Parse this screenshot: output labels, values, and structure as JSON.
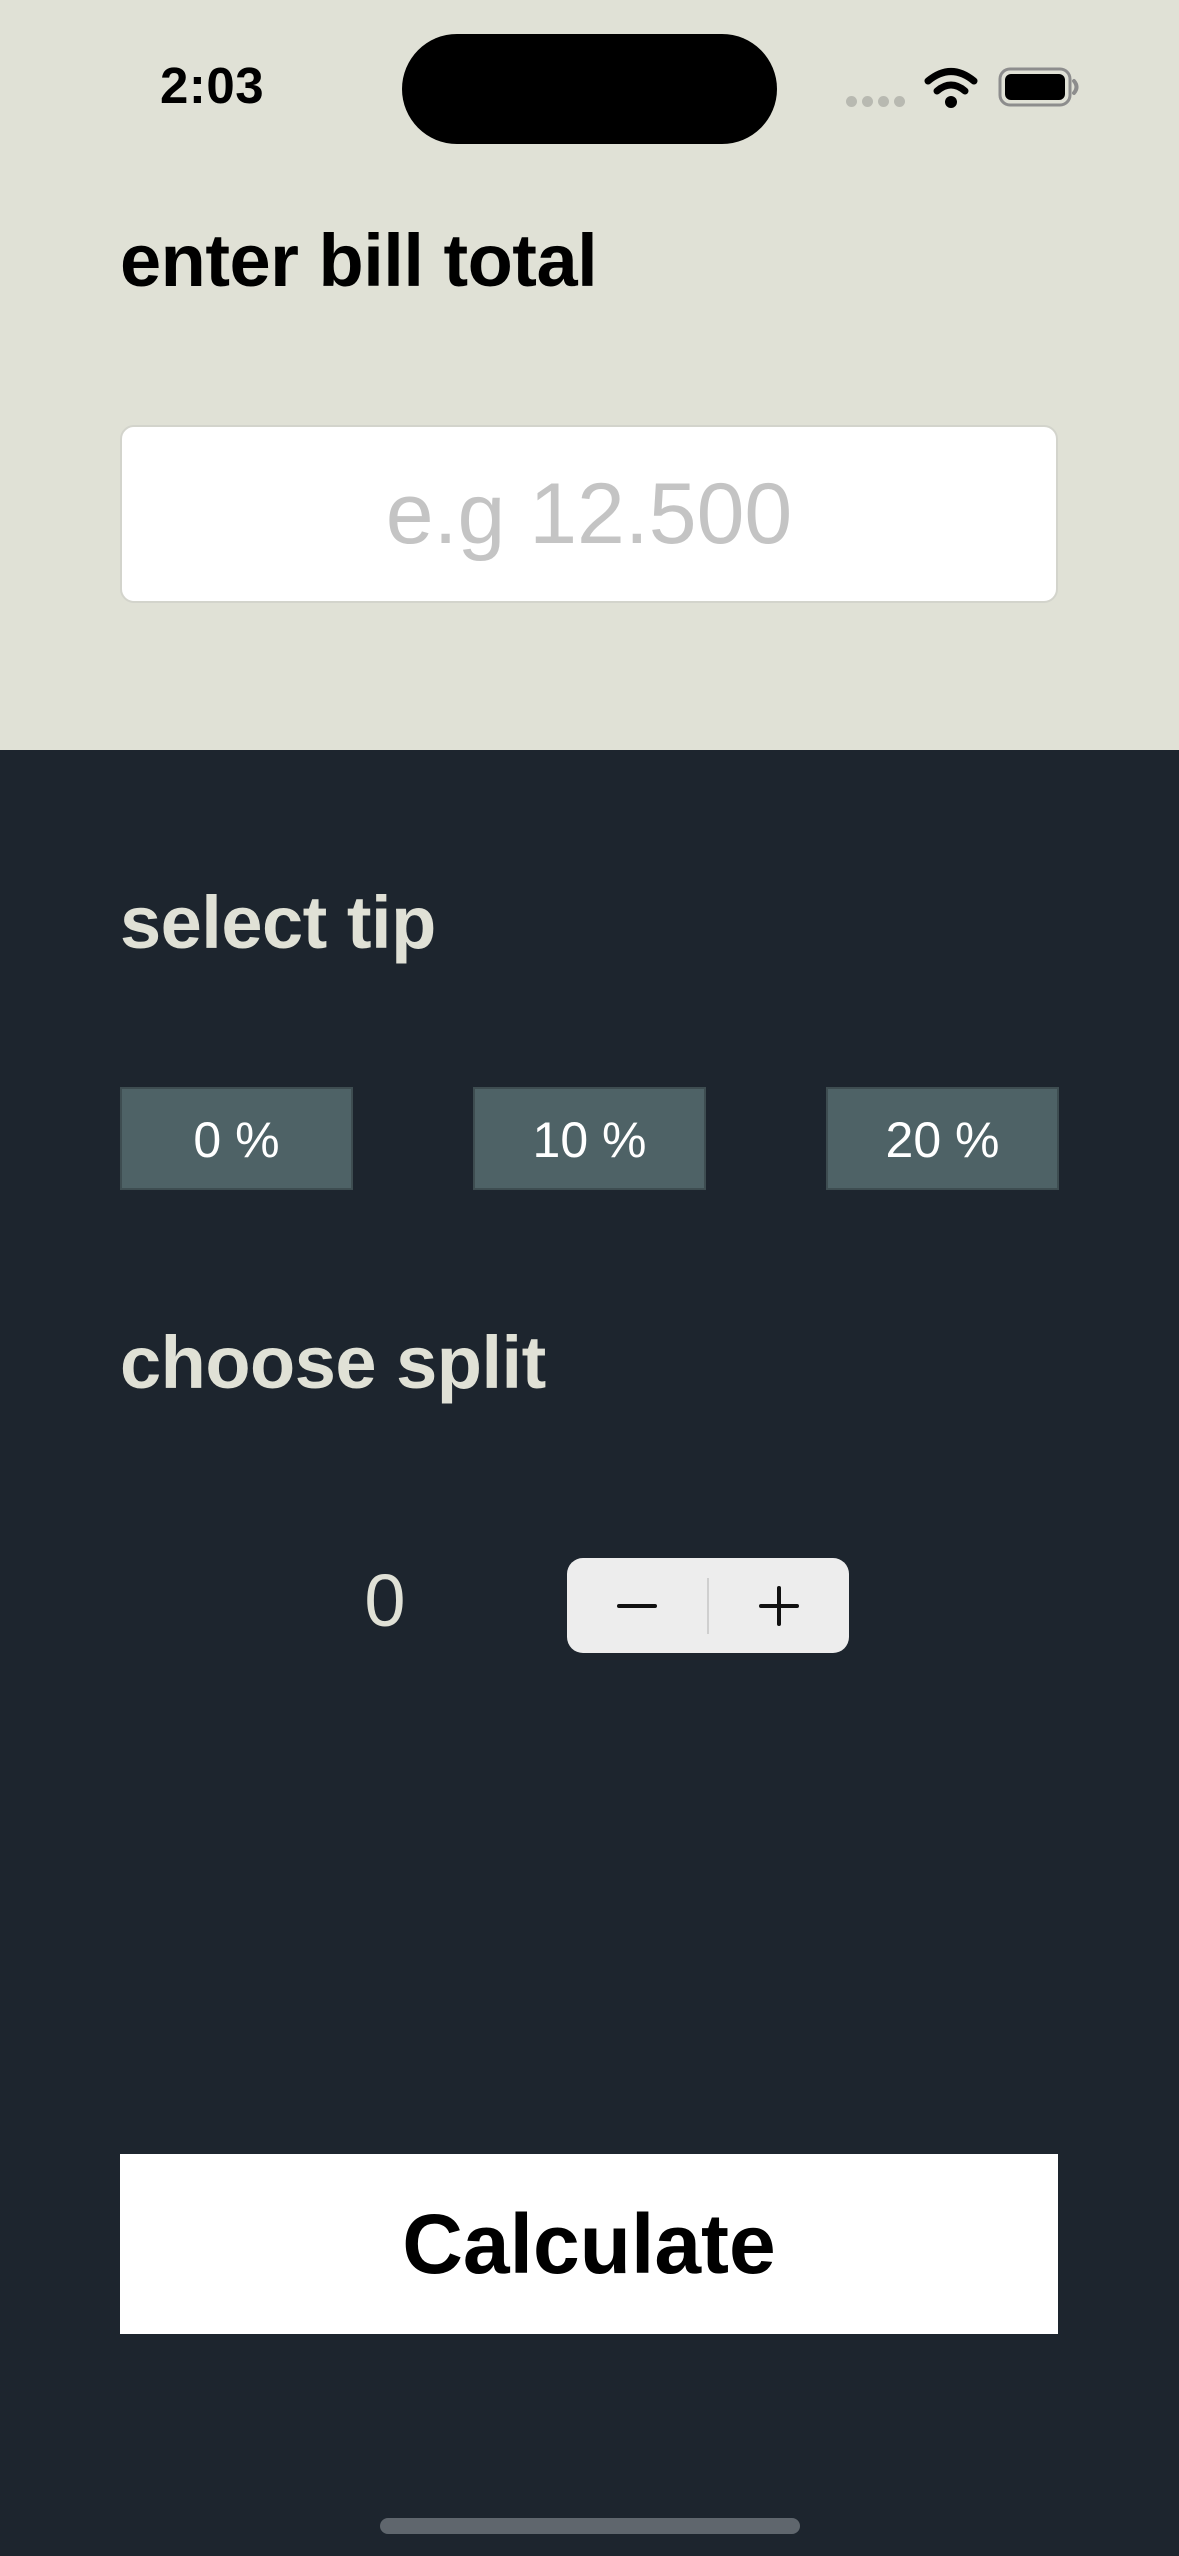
{
  "status_bar": {
    "time": "2:03",
    "icons": [
      "cellular-signal-icon",
      "wifi-icon",
      "battery-icon"
    ]
  },
  "bill": {
    "title": "enter bill total",
    "input_placeholder": "e.g 12.500",
    "input_value": ""
  },
  "tip": {
    "title": "select tip",
    "options": [
      "0 %",
      "10 %",
      "20 %"
    ]
  },
  "split": {
    "title": "choose split",
    "value": "0",
    "stepper_icons": [
      "minus-icon",
      "plus-icon"
    ]
  },
  "actions": {
    "calculate_label": "Calculate"
  },
  "colors": {
    "top_background": "#e0e1d6",
    "bottom_background": "#1d252e",
    "tip_button_background": "#4e6266",
    "calculate_button_background": "#ffffff"
  }
}
